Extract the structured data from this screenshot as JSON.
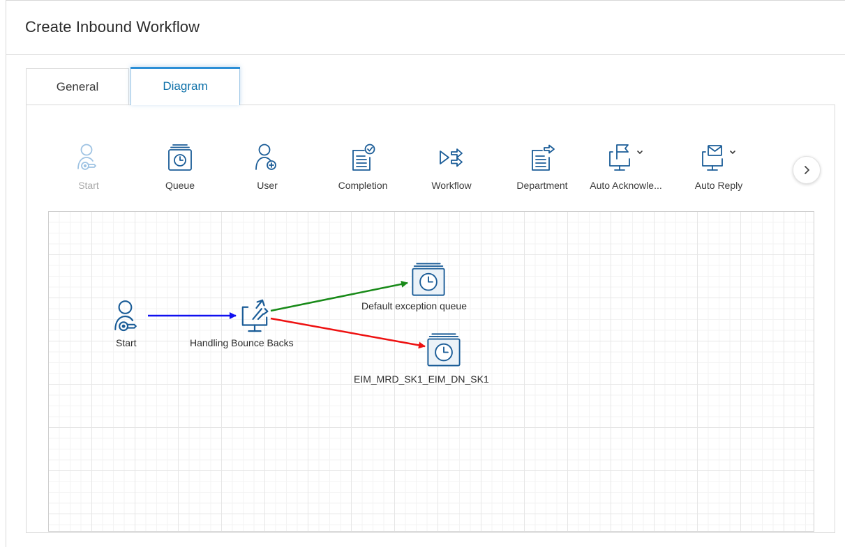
{
  "page": {
    "title": "Create Inbound Workflow"
  },
  "tabs": [
    {
      "label": "General",
      "active": false
    },
    {
      "label": "Diagram",
      "active": true
    }
  ],
  "palette": {
    "items": [
      {
        "label": "Start",
        "icon": "start-icon",
        "enabled": false
      },
      {
        "label": "Queue",
        "icon": "queue-icon",
        "enabled": true
      },
      {
        "label": "User",
        "icon": "add-user-icon",
        "enabled": true
      },
      {
        "label": "Completion",
        "icon": "completion-icon",
        "enabled": true
      },
      {
        "label": "Workflow",
        "icon": "workflow-icon",
        "enabled": true
      },
      {
        "label": "Department",
        "icon": "department-icon",
        "enabled": true
      },
      {
        "label": "Auto Acknowle...",
        "icon": "auto-acknowledgement-icon",
        "enabled": true,
        "has_dropdown": true
      },
      {
        "label": "Auto Reply",
        "icon": "auto-reply-icon",
        "enabled": true,
        "has_dropdown": true
      }
    ],
    "next_icon": "chevron-right-icon"
  },
  "diagram": {
    "nodes": {
      "start": {
        "label": "Start",
        "icon": "start-icon"
      },
      "bounce": {
        "label": "Handling Bounce Backs",
        "icon": "routing-icon"
      },
      "default_queue": {
        "label": "Default exception queue",
        "icon": "queue-icon"
      },
      "eim_queue": {
        "label": "EIM_MRD_SK1_EIM_DN_SK1",
        "icon": "queue-icon"
      }
    },
    "edge_colors": {
      "start_to_bounce": "#1010f0",
      "to_default": "#188a18",
      "to_eim": "#ee1111"
    }
  },
  "colors": {
    "accent": "#0b6fa8",
    "icon": "#1a5c97",
    "disabled": "#9fc3e3"
  }
}
